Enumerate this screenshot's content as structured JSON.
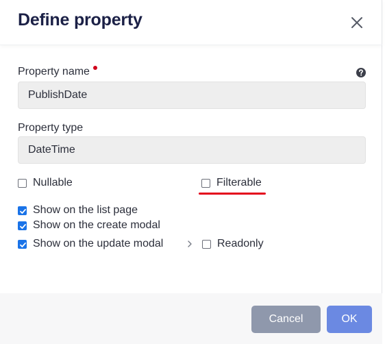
{
  "dialog": {
    "title": "Define property",
    "close_icon": "close-icon"
  },
  "fields": {
    "property_name": {
      "label": "Property name",
      "value": "PublishDate",
      "required": true,
      "help_icon": "question-circle-icon"
    },
    "property_type": {
      "label": "Property type",
      "value": "DateTime"
    }
  },
  "options": {
    "nullable": {
      "label": "Nullable",
      "checked": false
    },
    "filterable": {
      "label": "Filterable",
      "checked": false
    },
    "show_on_list": {
      "label": "Show on the list page",
      "checked": true
    },
    "show_on_create": {
      "label": "Show on the create modal",
      "checked": true
    },
    "show_on_update": {
      "label": "Show on the update modal",
      "checked": true
    },
    "readonly": {
      "label": "Readonly",
      "checked": false
    }
  },
  "annotation": {
    "underline_color": "#e4001b",
    "target": "filterable"
  },
  "footer": {
    "cancel_label": "Cancel",
    "ok_label": "OK"
  },
  "colors": {
    "title": "#1b2046",
    "checkbox_checked": "#1a73e8",
    "required_dot": "#d0021b",
    "cancel_button": "#8f98ac",
    "ok_button": "#6b89e2"
  }
}
